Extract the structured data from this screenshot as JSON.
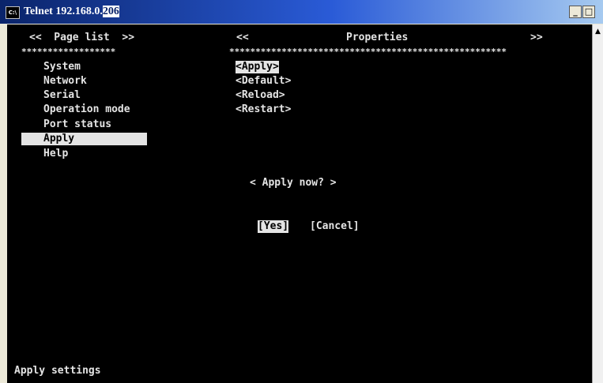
{
  "window": {
    "title_prefix": "Telnet 192.168.0.",
    "title_suffix": "206",
    "icon_label": "C:\\"
  },
  "titlebar_buttons": {
    "minimize": "_",
    "maximize": "□"
  },
  "page_list": {
    "header": "<<  Page list  >>",
    "separator": "******************",
    "items": [
      "System",
      "Network",
      "Serial",
      "Operation mode",
      "Port status",
      "Apply",
      "Help"
    ],
    "selected": "Apply"
  },
  "properties": {
    "nav_left": "<<",
    "header": "Properties",
    "nav_right": ">>",
    "separator": "*****************************************************",
    "actions": [
      "<Apply>",
      "<Default>",
      "<Reload>",
      "<Restart>"
    ]
  },
  "dialog": {
    "prompt": "< Apply now? >",
    "yes": "[Yes]",
    "cancel": "[Cancel]"
  },
  "status": "Apply settings"
}
